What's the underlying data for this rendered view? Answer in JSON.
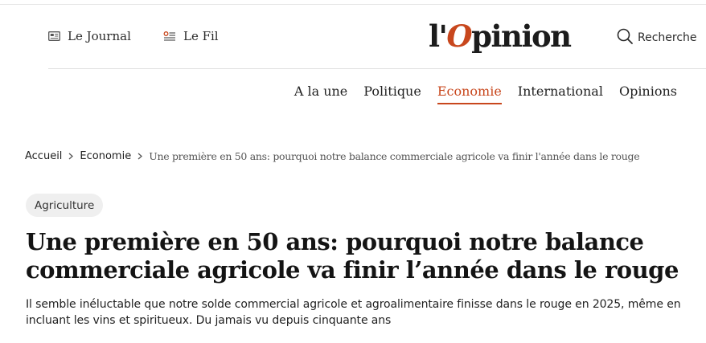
{
  "header": {
    "journal_label": "Le Journal",
    "fil_label": "Le Fil",
    "logo": {
      "prefix": "l'",
      "accent": "O",
      "rest": "pinion"
    },
    "search_label": "Recherche",
    "accent_color": "#c8471d"
  },
  "nav": {
    "items": [
      {
        "label": "A la une",
        "active": false
      },
      {
        "label": "Politique",
        "active": false
      },
      {
        "label": "Economie",
        "active": true
      },
      {
        "label": "International",
        "active": false
      },
      {
        "label": "Opinions",
        "active": false
      }
    ]
  },
  "breadcrumb": {
    "home": "Accueil",
    "section": "Economie",
    "current": "Une première en 50 ans: pourquoi notre balance commerciale agricole va finir l'année dans le rouge",
    "separator_icon": "chevron-right-icon"
  },
  "article": {
    "tag": "Agriculture",
    "title": "Une première en 50 ans: pourquoi notre balance commerciale agricole va finir l’année dans le rouge",
    "lede": "Il semble inéluctable que notre solde commercial agricole et agroalimentaire finisse dans le rouge en 2025, même en incluant les vins et spiritueux. Du jamais vu depuis cinquante ans"
  }
}
